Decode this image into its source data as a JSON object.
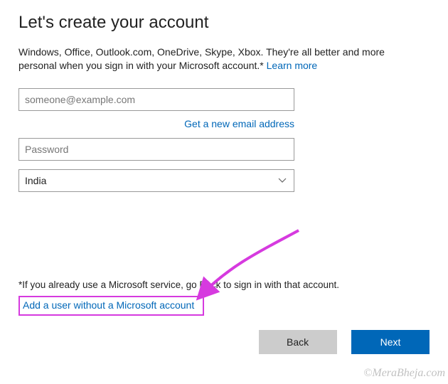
{
  "title": "Let's create your account",
  "intro_text": "Windows, Office, Outlook.com, OneDrive, Skype, Xbox. They're all better and more personal when you sign in with your Microsoft account.* ",
  "learn_more": "Learn more",
  "form": {
    "email_placeholder": "someone@example.com",
    "email_value": "",
    "new_email_link": "Get a new email address",
    "password_placeholder": "Password",
    "password_value": "",
    "country_value": "India"
  },
  "note": "*If you already use a Microsoft service, go Back to sign in with that account.",
  "alt_link": "Add a user without a Microsoft account",
  "buttons": {
    "back": "Back",
    "next": "Next"
  },
  "watermark": "©MeraBheja.com",
  "colors": {
    "accent": "#0067b8",
    "highlight": "#d63adf"
  }
}
